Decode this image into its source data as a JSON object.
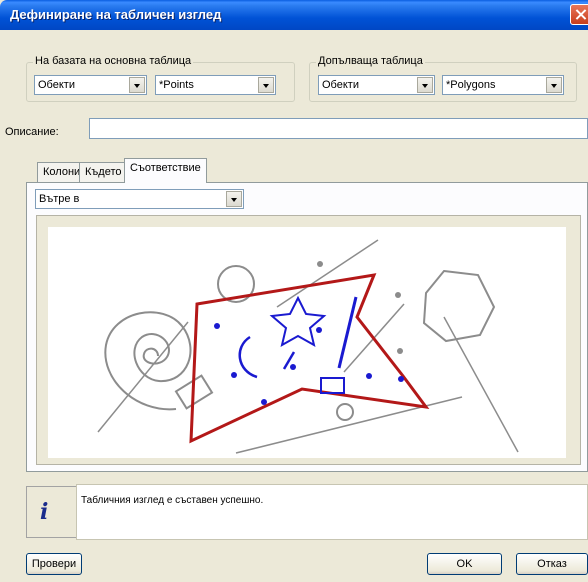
{
  "window": {
    "title": "Дефиниране на табличен изглед"
  },
  "base_table": {
    "legend": "На базата на основна таблица",
    "category": "Обекти",
    "table": "*Points"
  },
  "join_table": {
    "legend": "Допълваща таблица",
    "category": "Обекти",
    "table": "*Polygons"
  },
  "description": {
    "label": "Описание:",
    "value": ""
  },
  "tabs": [
    {
      "label": "Колони"
    },
    {
      "label": "Където"
    },
    {
      "label": "Съответствие"
    }
  ],
  "relation": {
    "selected": "Вътре в"
  },
  "status": {
    "message": "Табличния изглед е съставен успешно."
  },
  "buttons": {
    "check": "Провери",
    "ok": "OK",
    "cancel": "Отказ"
  },
  "colors": {
    "polygon_outline": "#b31818",
    "inside_objects": "#1a1ad0",
    "outside_objects": "#8c8c8c",
    "title_bar": "#0054e3"
  },
  "icons": {
    "info": "info-icon",
    "close": "close-icon",
    "dropdown": "chevron-down-icon"
  }
}
